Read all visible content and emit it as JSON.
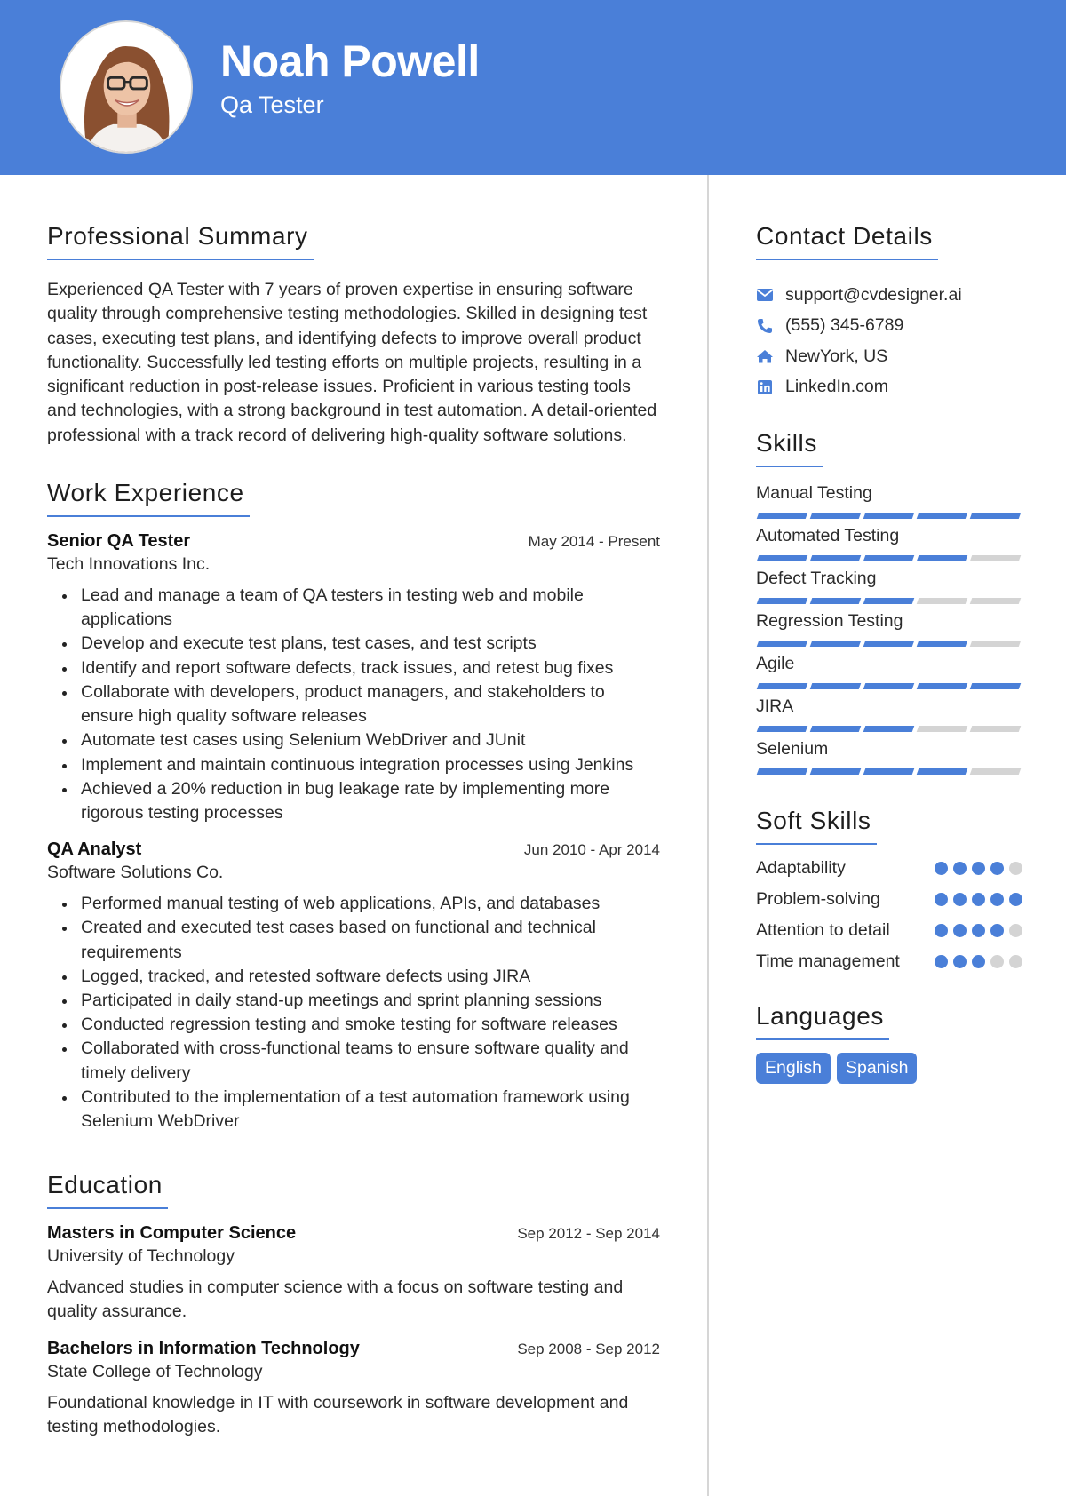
{
  "header": {
    "name": "Noah Powell",
    "role": "Qa Tester",
    "accent_color": "#4a7fd8"
  },
  "summary": {
    "title": "Professional Summary",
    "text": "Experienced QA Tester with 7 years of proven expertise in ensuring software quality through comprehensive testing methodologies. Skilled in designing test cases, executing test plans, and identifying defects to improve overall product functionality. Successfully led testing efforts on multiple projects, resulting in a significant reduction in post-release issues. Proficient in various testing tools and technologies, with a strong background in test automation. A detail-oriented professional with a track record of delivering high-quality software solutions."
  },
  "experience": {
    "title": "Work Experience",
    "jobs": [
      {
        "title": "Senior QA Tester",
        "date": "May 2014 - Present",
        "org": "Tech Innovations Inc.",
        "bullets": [
          "Lead and manage a team of QA testers in testing web and mobile applications",
          "Develop and execute test plans, test cases, and test scripts",
          "Identify and report software defects, track issues, and retest bug fixes",
          "Collaborate with developers, product managers, and stakeholders to ensure high quality software releases",
          "Automate test cases using Selenium WebDriver and JUnit",
          "Implement and maintain continuous integration processes using Jenkins",
          "Achieved a 20% reduction in bug leakage rate by implementing more rigorous testing processes"
        ]
      },
      {
        "title": "QA Analyst",
        "date": "Jun 2010 - Apr 2014",
        "org": "Software Solutions Co.",
        "bullets": [
          "Performed manual testing of web applications, APIs, and databases",
          "Created and executed test cases based on functional and technical requirements",
          "Logged, tracked, and retested software defects using JIRA",
          "Participated in daily stand-up meetings and sprint planning sessions",
          "Conducted regression testing and smoke testing for software releases",
          "Collaborated with cross-functional teams to ensure software quality and timely delivery",
          "Contributed to the implementation of a test automation framework using Selenium WebDriver"
        ]
      }
    ]
  },
  "education": {
    "title": "Education",
    "items": [
      {
        "degree": "Masters in Computer Science",
        "date": "Sep 2012 - Sep 2014",
        "school": "University of Technology",
        "desc": "Advanced studies in computer science with a focus on software testing and quality assurance."
      },
      {
        "degree": "Bachelors in Information Technology",
        "date": "Sep 2008 - Sep 2012",
        "school": "State College of Technology",
        "desc": "Foundational knowledge in IT with coursework in software development and testing methodologies."
      }
    ]
  },
  "contact": {
    "title": "Contact Details",
    "items": [
      {
        "icon": "envelope-icon",
        "text": "support@cvdesigner.ai"
      },
      {
        "icon": "phone-icon",
        "text": "(555) 345-6789"
      },
      {
        "icon": "home-icon",
        "text": "NewYork, US"
      },
      {
        "icon": "linkedin-icon",
        "text": "LinkedIn.com"
      }
    ]
  },
  "skills": {
    "title": "Skills",
    "max": 5,
    "items": [
      {
        "name": "Manual Testing",
        "level": 5
      },
      {
        "name": "Automated Testing",
        "level": 4
      },
      {
        "name": "Defect Tracking",
        "level": 3
      },
      {
        "name": "Regression Testing",
        "level": 4
      },
      {
        "name": "Agile",
        "level": 5
      },
      {
        "name": "JIRA",
        "level": 3
      },
      {
        "name": "Selenium",
        "level": 4
      }
    ]
  },
  "soft_skills": {
    "title": "Soft Skills",
    "max": 5,
    "items": [
      {
        "name": "Adaptability",
        "level": 4
      },
      {
        "name": "Problem-solving",
        "level": 5
      },
      {
        "name": "Attention to detail",
        "level": 4
      },
      {
        "name": "Time management",
        "level": 3
      }
    ]
  },
  "languages": {
    "title": "Languages",
    "items": [
      "English",
      "Spanish"
    ]
  }
}
